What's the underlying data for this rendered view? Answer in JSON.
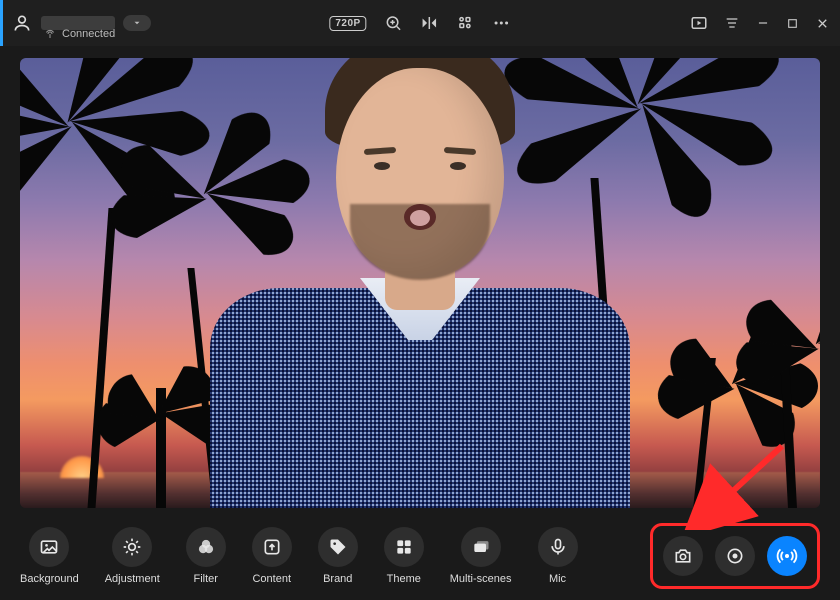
{
  "titlebar": {
    "status_label": "Connected",
    "resolution_label": "720P"
  },
  "tools": [
    {
      "key": "background",
      "label": "Background"
    },
    {
      "key": "adjustment",
      "label": "Adjustment"
    },
    {
      "key": "filter",
      "label": "Filter"
    },
    {
      "key": "content",
      "label": "Content"
    },
    {
      "key": "brand",
      "label": "Brand"
    },
    {
      "key": "theme",
      "label": "Theme"
    },
    {
      "key": "multi_scenes",
      "label": "Multi-scenes"
    },
    {
      "key": "mic",
      "label": "Mic"
    }
  ],
  "colors": {
    "accent": "#0a84ff",
    "annotation": "#ff2a2a"
  }
}
